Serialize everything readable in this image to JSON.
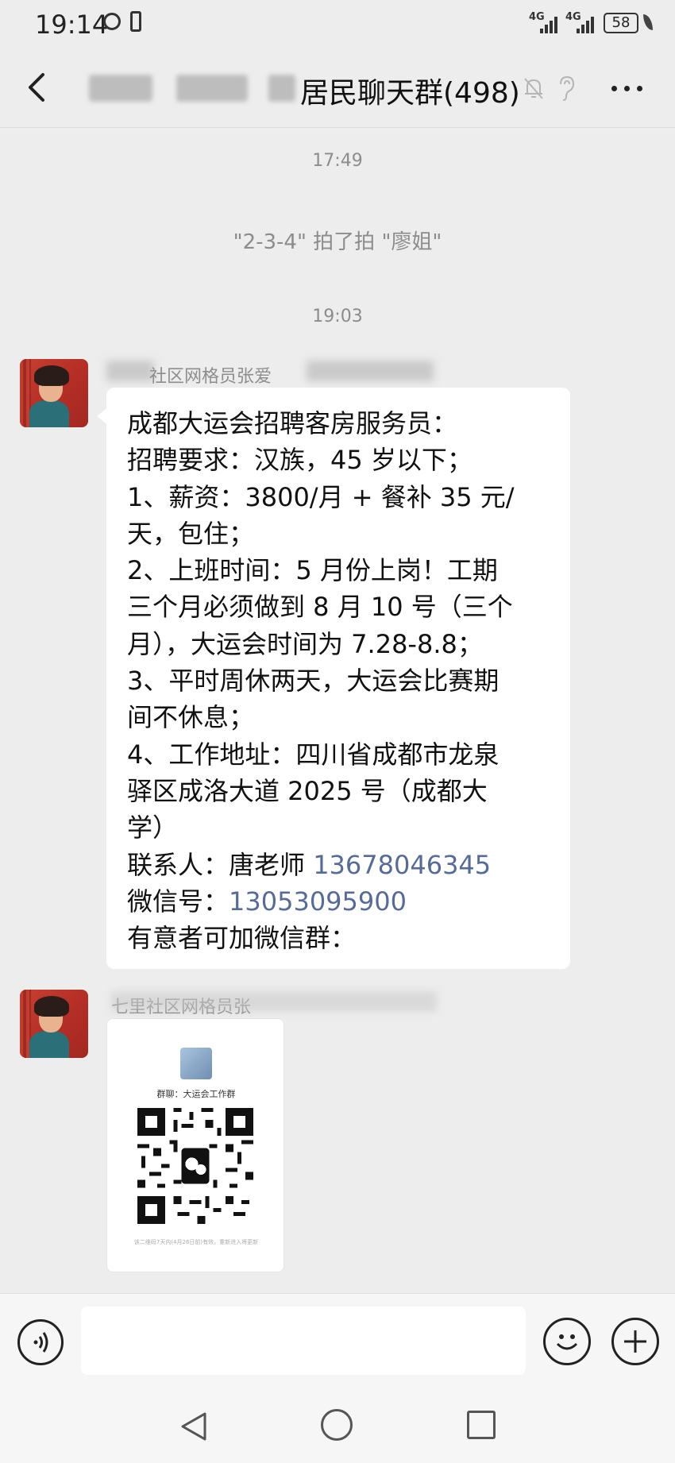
{
  "status_bar": {
    "time": "19:14",
    "network_1": "4G",
    "network_2": "4G",
    "battery": "58"
  },
  "header": {
    "title": "居民聊天群(498)"
  },
  "chat": {
    "time_1": "17:49",
    "system_message": "\"2-3-4\" 拍了拍 \"廖姐\"",
    "time_2": "19:03",
    "message_1": {
      "sender": "社区网格员张爱",
      "lines": [
        "成都大运会招聘客房服务员：",
        "招聘要求：汉族，45 岁以下；",
        "1、薪资：3800/月 + 餐补 35 元/",
        "天，包住；",
        "2、上班时间：5 月份上岗！工期",
        "三个月必须做到 8 月 10 号（三个",
        "月），大运会时间为 7.28-8.8；",
        "3、平时周休两天，大运会比赛期",
        "间不休息；",
        "4、工作地址：四川省成都市龙泉",
        "驿区成洛大道 2025 号（成都大",
        "学）"
      ],
      "contact_label": "联系人：唐老师 ",
      "contact_phone": "13678046345",
      "wechat_label": "微信号：",
      "wechat_id": "13053095900",
      "closing_line": "有意者可加微信群："
    },
    "message_2": {
      "sender": "七里社区网格员张",
      "qr_group_name": "群聊：大运会工作群",
      "qr_footer": "该二维码7天内(4月26日前)有效，重新进入将更新"
    }
  },
  "input": {
    "placeholder": ""
  }
}
